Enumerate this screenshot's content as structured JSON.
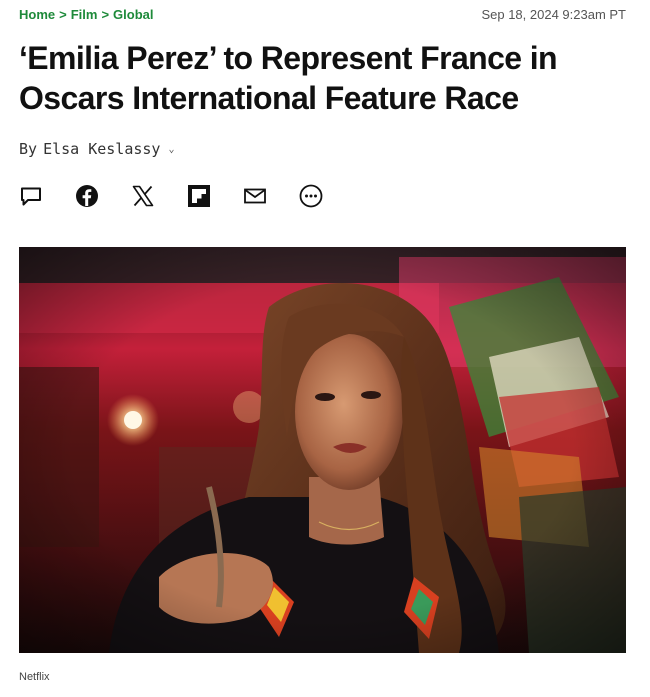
{
  "breadcrumb": {
    "items": [
      "Home",
      "Film",
      "Global"
    ],
    "separator": ">"
  },
  "timestamp": "Sep 18, 2024 9:23am PT",
  "headline": "‘Emilia Perez’ to Represent France in Oscars International Feature Race",
  "byline": {
    "prefix": "By",
    "author": "Elsa Keslassy"
  },
  "share": {
    "icons": [
      "comment-icon",
      "facebook-icon",
      "x-icon",
      "flipboard-icon",
      "email-icon",
      "more-icon"
    ]
  },
  "hero_image": {
    "caption": "Netflix"
  },
  "colors": {
    "breadcrumb": "#1e8a3a",
    "headline": "#111111",
    "timestamp": "#555555"
  }
}
